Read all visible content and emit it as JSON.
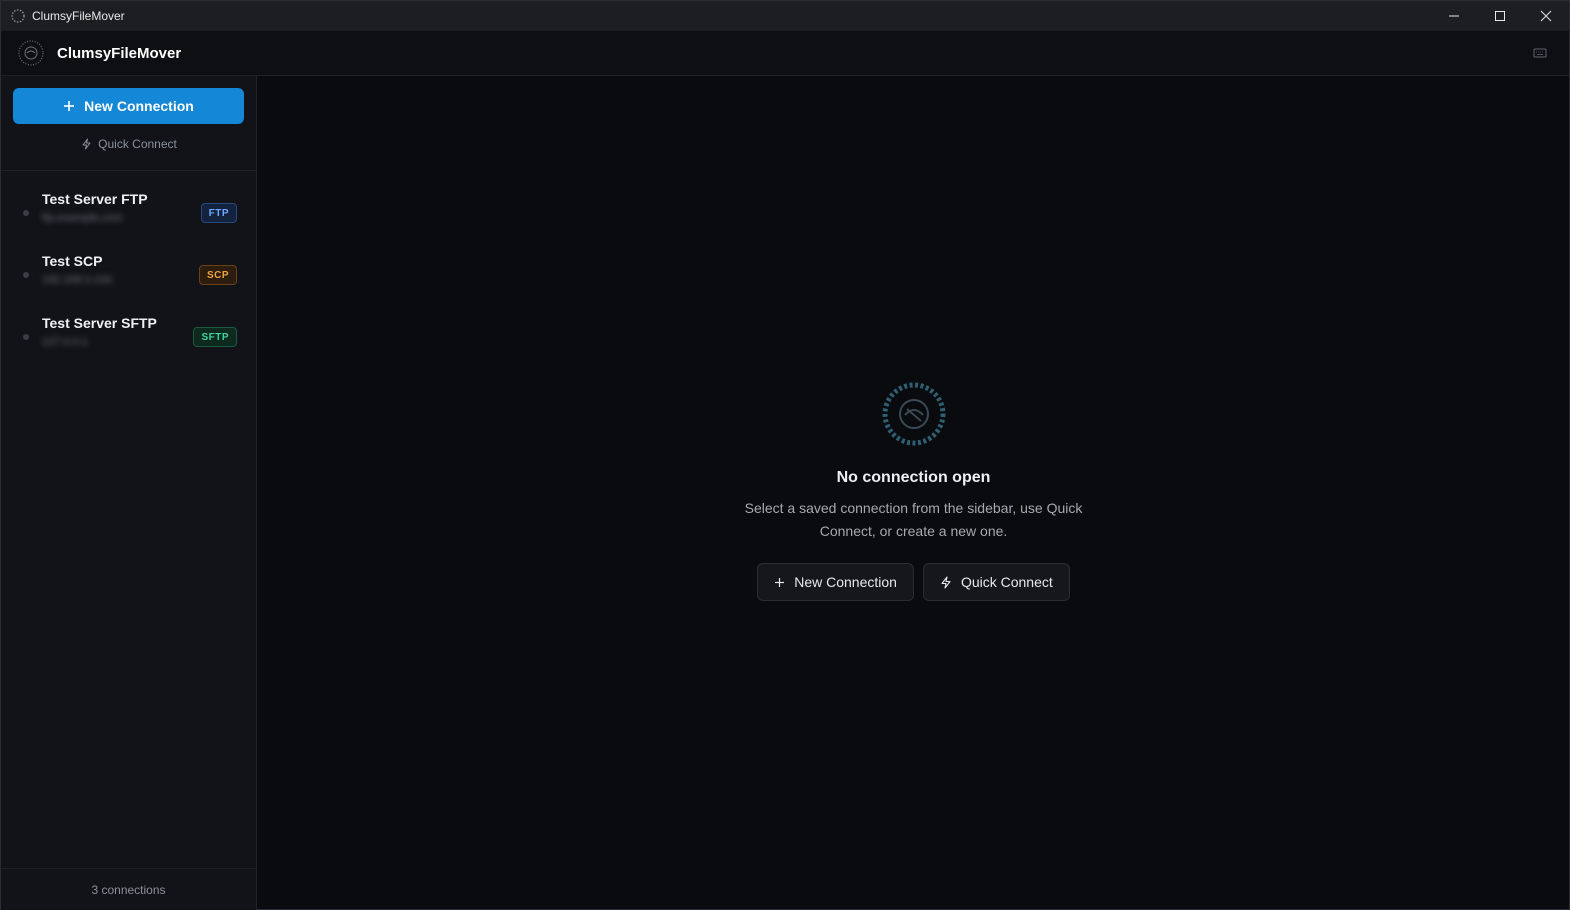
{
  "window": {
    "title": "ClumsyFileMover",
    "controls": [
      "minimize-icon",
      "maximize-icon",
      "close-icon"
    ]
  },
  "header": {
    "app_name": "ClumsyFileMover",
    "action_icon": "keyboard-icon"
  },
  "sidebar": {
    "new_connection_label": "New Connection",
    "quick_connect_label": "Quick Connect",
    "connections": [
      {
        "name": "Test Server FTP",
        "host": "ftp.example.com",
        "protocol": "FTP"
      },
      {
        "name": "Test SCP",
        "host": "192.168.0.100",
        "protocol": "SCP"
      },
      {
        "name": "Test Server SFTP",
        "host": "127.0.0.1",
        "protocol": "SFTP"
      }
    ],
    "footer": "3 connections"
  },
  "main": {
    "empty_title": "No connection open",
    "empty_description": "Select a saved connection from the sidebar, use Quick Connect, or create a new one.",
    "new_connection_label": "New Connection",
    "quick_connect_label": "Quick Connect"
  },
  "colors": {
    "accent": "#1487d6",
    "background": "#0a0b0e",
    "sidebar": "#111318",
    "ftp": "#6ea8ff",
    "scp": "#f2a23c",
    "sftp": "#3ed39a"
  }
}
